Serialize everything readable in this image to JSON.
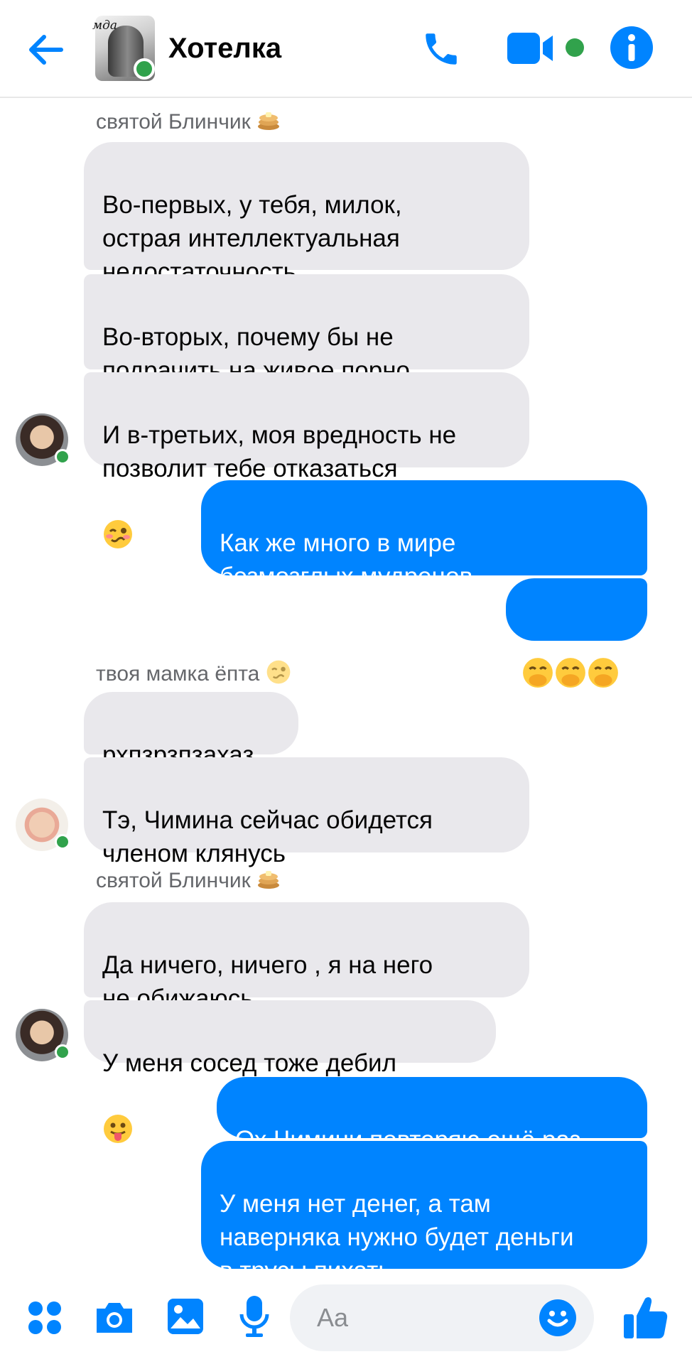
{
  "header": {
    "title": "Хотелка",
    "avatar_caption": "мда",
    "accent": "#0084ff",
    "online_color": "#31a24c"
  },
  "messages": {
    "block1": {
      "sender": "святой Блинчик",
      "m1": "Во-первых, у тебя, милок,\nострая интеллектуальная\nнедостаточность",
      "m2": "Во-вторых, почему бы не\nподрачить на живое порно",
      "m3": "И в-третьих, моя вредность не\nпозволит тебе отказаться"
    },
    "out1": {
      "m1": "Как же много в мире\nбезмозглых мудрецов"
    },
    "block2": {
      "sender": "твоя мамка ёпта",
      "m1": "рхпзрзпзахаз",
      "m2": "Тэ, Чимина сейчас обидется\nчленом клянусь"
    },
    "block3": {
      "sender": "святой Блинчик",
      "m1": "Да ничего, ничего , я на него\nне обижаюсь",
      "m2": "У меня сосед тоже дебил"
    },
    "out2": {
      "m1": "Ох Чимини повторяю ещё раз",
      "m2": "У меня нет денег, а там\nнаверняка нужно будет деньги\nв трусы пихать"
    }
  },
  "composer": {
    "placeholder": "Aa"
  },
  "icons": [
    "back-arrow-icon",
    "phone-icon",
    "video-icon",
    "info-icon",
    "apps-icon",
    "camera-icon",
    "gallery-icon",
    "microphone-icon",
    "emoji-icon",
    "like-icon"
  ]
}
